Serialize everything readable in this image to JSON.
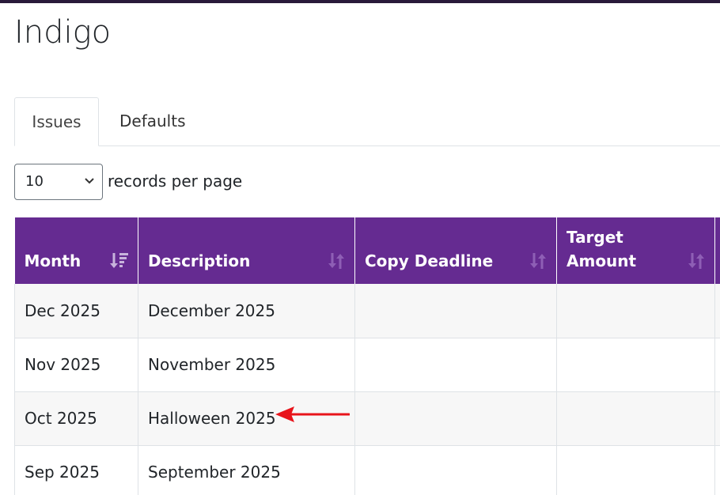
{
  "app": {
    "title": "Indigo"
  },
  "tabs": [
    {
      "label": "Issues",
      "active": true
    },
    {
      "label": "Defaults",
      "active": false
    }
  ],
  "page_size": {
    "value": "10",
    "label": "records per page"
  },
  "table": {
    "columns": [
      {
        "label": "Month",
        "sort": "sorted-desc-icon"
      },
      {
        "label": "Description",
        "sort": "sort-icon"
      },
      {
        "label": "Copy Deadline",
        "sort": "sort-icon"
      },
      {
        "label": "Target Amount",
        "sort": "sort-icon"
      }
    ],
    "rows": [
      {
        "month": "Dec 2025",
        "description": "December 2025",
        "copy_deadline": "",
        "target_amount": ""
      },
      {
        "month": "Nov 2025",
        "description": "November 2025",
        "copy_deadline": "",
        "target_amount": ""
      },
      {
        "month": "Oct 2025",
        "description": "Halloween 2025",
        "copy_deadline": "",
        "target_amount": ""
      },
      {
        "month": "Sep 2025",
        "description": "September 2025",
        "copy_deadline": "",
        "target_amount": ""
      }
    ]
  },
  "annotation": {
    "icon": "red-arrow-icon",
    "color": "#e8141b"
  },
  "colors": {
    "header_bg": "#652b91",
    "top_bar": "#2a1a3a"
  }
}
